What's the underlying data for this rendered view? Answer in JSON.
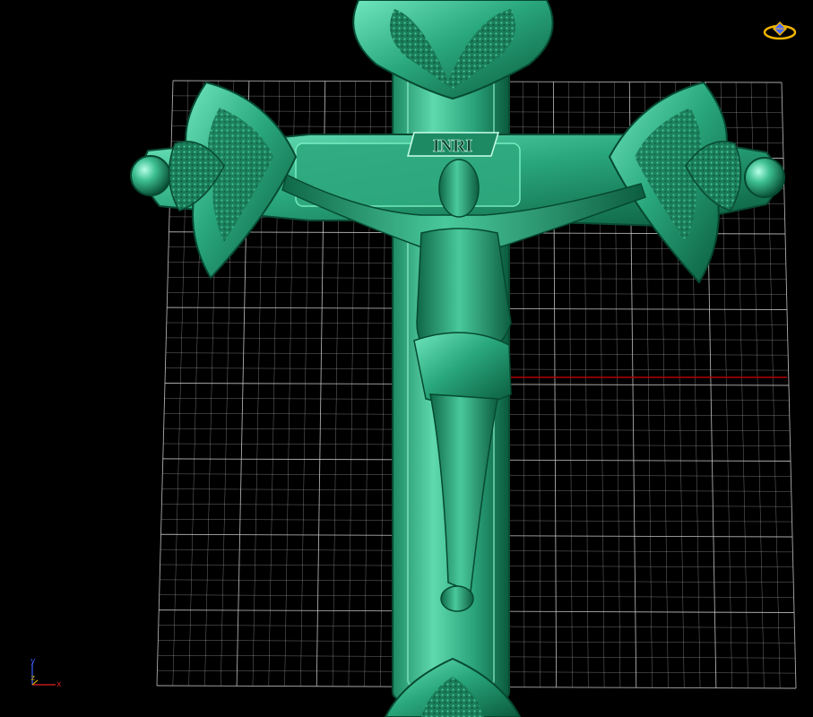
{
  "viewport": {
    "background": "#000000",
    "grid_color": "#c8c8c8",
    "model_color": "#2fb88c",
    "model_highlight": "#7ff2c6",
    "model_shadow": "#06442f",
    "axis_line_color": "#b00000"
  },
  "model": {
    "name": "crucifix",
    "inscription": "INRI"
  },
  "axes": {
    "y_label": "y",
    "z_label": "z",
    "x_label": "x",
    "y_color": "#3a5cff",
    "z_color": "#c8a400",
    "x_color": "#e02020"
  },
  "view_cube": {
    "icon": "view-orientation-icon",
    "color": "#f0b400"
  }
}
